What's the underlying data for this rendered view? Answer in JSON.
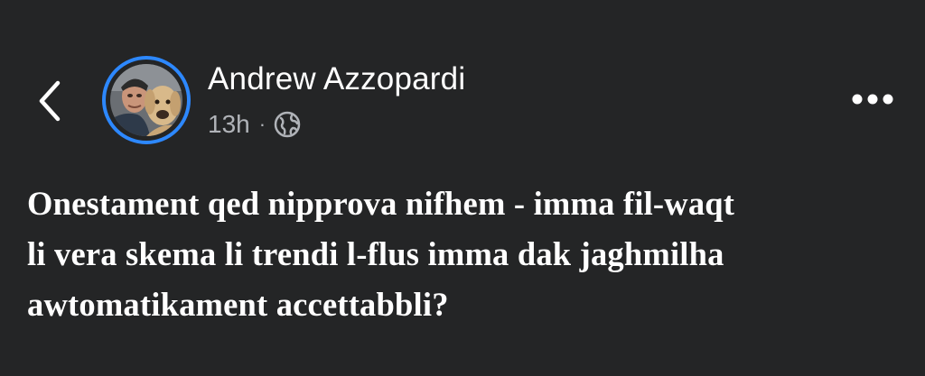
{
  "post": {
    "author_name": "Andrew Azzopardi",
    "timestamp": "13h",
    "separator": "·",
    "audience_icon": "globe-icon",
    "text_lines": [
      "Onestament qed nipprova nifhem - imma fil-waqt",
      "li vera skema li trendi l-flus imma dak jaghmilha",
      "awtomatikament accettabbli?"
    ]
  },
  "header": {
    "back_icon": "chevron-left-icon",
    "more_icon": "more-horizontal-icon"
  },
  "colors": {
    "background": "#242526",
    "text_primary": "#ffffff",
    "text_secondary": "#b0b3b8",
    "story_ring": "#2d88ff"
  }
}
